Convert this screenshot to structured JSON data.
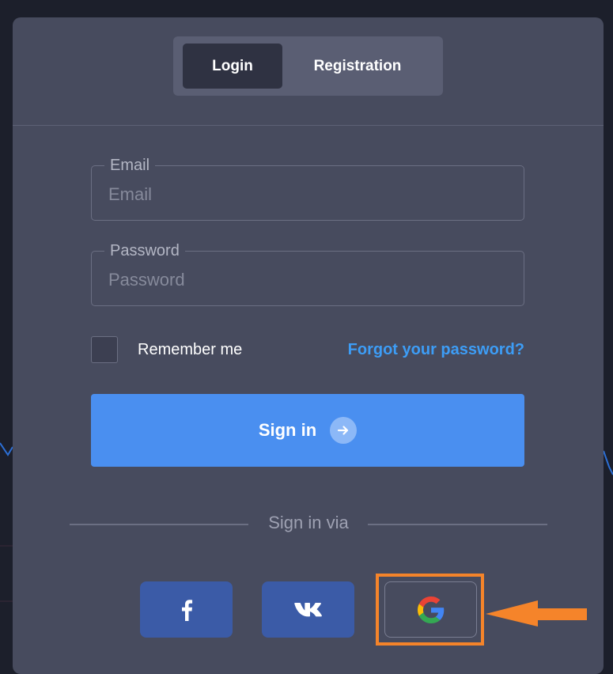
{
  "tabs": {
    "login": "Login",
    "registration": "Registration",
    "active": "login"
  },
  "form": {
    "email": {
      "label": "Email",
      "placeholder": "Email",
      "value": ""
    },
    "password": {
      "label": "Password",
      "placeholder": "Password",
      "value": ""
    },
    "remember_label": "Remember me",
    "remember_checked": false,
    "forgot_label": "Forgot your password?",
    "signin_label": "Sign in"
  },
  "sign_in_via": {
    "label": "Sign in via",
    "providers": [
      {
        "name": "facebook",
        "icon": "facebook-icon",
        "color": "#3b5ba7"
      },
      {
        "name": "vk",
        "icon": "vk-icon",
        "color": "#3b5ba7"
      },
      {
        "name": "google",
        "icon": "google-icon",
        "highlighted": true
      }
    ]
  },
  "colors": {
    "background": "#1c1f2b",
    "card": "#474b5e",
    "accent": "#4a8ff0",
    "link": "#3d9df6",
    "highlight": "#f5842a"
  }
}
